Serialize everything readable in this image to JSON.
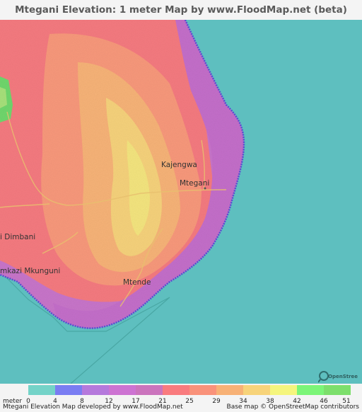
{
  "title": "Mtegani Elevation: 1 meter Map by www.FloodMap.net (beta)",
  "map": {
    "sea_color": "#5ebfbf",
    "places": [
      {
        "name": "Kajengwa"
      },
      {
        "name": "Mtegani"
      },
      {
        "name": "i Dimbani"
      },
      {
        "name": "mkazi Mkunguni"
      },
      {
        "name": "Mtende"
      }
    ]
  },
  "legend": {
    "unit": "meter",
    "ticks": [
      "0",
      "4",
      "8",
      "12",
      "17",
      "21",
      "25",
      "29",
      "34",
      "38",
      "42",
      "46",
      "51"
    ],
    "colors": [
      "#74d3c8",
      "#7a7df2",
      "#b579dc",
      "#cd73d2",
      "#cb74bd",
      "#f97b7e",
      "#f9927a",
      "#f7b176",
      "#f7d37a",
      "#f5f57d",
      "#7cf578",
      "#7ddf6c"
    ]
  },
  "footer": {
    "left": "Mtegani Elevation Map developed by www.FloodMap.net",
    "right": "Base map © OpenStreetMap contributors"
  },
  "osm_logo_text": "OpenStreetMap"
}
